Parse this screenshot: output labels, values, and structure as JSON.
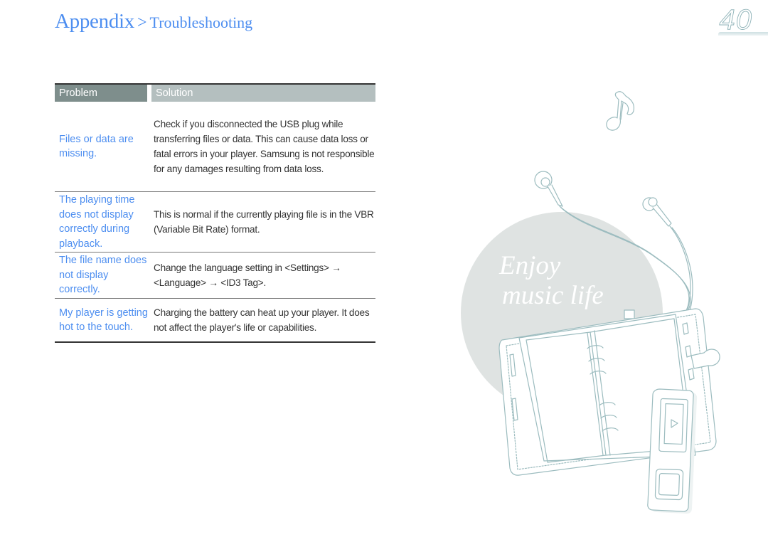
{
  "header": {
    "section": "Appendix",
    "separator": ">",
    "subsection": "Troubleshooting",
    "page_number": "40"
  },
  "table": {
    "columns": [
      "Problem",
      "Solution"
    ],
    "rows": [
      {
        "problem": "Files or data are missing.",
        "solution": "Check if you disconnected the USB plug while transferring files or data. This can cause data loss or fatal errors in your player. Samsung is not responsible for any damages resulting from data loss."
      },
      {
        "problem": "The playing time does not display correctly during playback.",
        "solution": "This is normal if the currently playing file is in the VBR (Variable Bit Rate) format."
      },
      {
        "problem": "The file name does not display correctly.",
        "solution": "Change the language setting in <Settings> → <Language> → <ID3 Tag>."
      },
      {
        "problem": "My player is getting hot to the touch.",
        "solution": "Charging the battery can heat up your player. It does not affect the player's life or capabilities."
      }
    ]
  },
  "illustration": {
    "tagline_line1": "Enjoy",
    "tagline_line2": "music life",
    "icons": [
      "music-note-icon",
      "earphones-icon",
      "planner-icon",
      "mp3-player-icon"
    ]
  },
  "colors": {
    "accent_blue": "#4d8ef0",
    "header_problem_bg": "#7e8e8c",
    "header_solution_bg": "#b4bfbf",
    "circle_bg": "#dfe3e2",
    "line_art": "#9cbcbf"
  }
}
